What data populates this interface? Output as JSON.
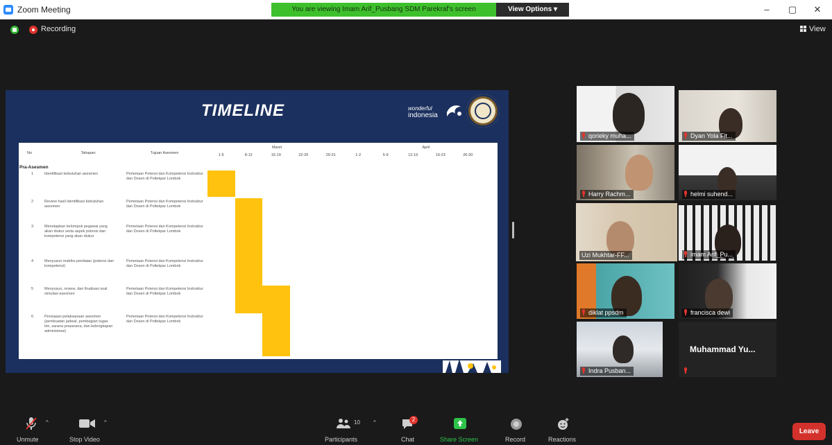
{
  "window": {
    "title": "Zoom Meeting",
    "share_banner": "You are viewing Imam Arif_Pusbang SDM Parekraf's screen",
    "view_options": "View Options ▾",
    "minimize": "–",
    "maximize": "▢",
    "close": "✕"
  },
  "status": {
    "recording_label": "Recording",
    "view_label": "View"
  },
  "slide": {
    "title": "TIMELINE",
    "brand_line1": "wonderful",
    "brand_line2": "indonesia",
    "table": {
      "headers": {
        "no": "No",
        "tahapan": "Tahapan",
        "tujuan": "Tujuan Asesmen",
        "month1": "Maret",
        "month2": "April"
      },
      "date_columns": [
        "1-5",
        "8-12",
        "15-19",
        "22-26",
        "29-31",
        "1-2",
        "5-9",
        "12-16",
        "19-23",
        "26-30"
      ],
      "section_label": "Pra-Asesmen",
      "rows": [
        {
          "no": "1",
          "tahapan": "Identifikasi kebutuhan asesmen",
          "tujuan": "Pemetaan Potensi dan Kompetensi Instruktur dan Dosen di Poltekpar Lombok",
          "bar_start": 0,
          "bar_span": 1
        },
        {
          "no": "2",
          "tahapan": "Review hasil identifikasi kebutuhan asesmen",
          "tujuan": "Pemetaan Potensi dan Kompetensi Instruktur dan Dosen di Poltekpar Lombok",
          "bar_start": 1,
          "bar_span": 1
        },
        {
          "no": "3",
          "tahapan": "Menetapkan kelompok pegawai yang akan diukur serta aspek potensi dan kompetensi yang akan diukur",
          "tujuan": "Pemetaan Potensi dan Kompetensi Instruktur dan Dosen di Poltekpar Lombok",
          "bar_start": 1,
          "bar_span": 1
        },
        {
          "no": "4",
          "tahapan": "Menyusun matriks penilaian (potensi dan kompetensi)",
          "tujuan": "Pemetaan Potensi dan Kompetensi Instruktur dan Dosen di Poltekpar Lombok",
          "bar_start": 1,
          "bar_span": 1
        },
        {
          "no": "5",
          "tahapan": "Menyusun, review, dan finalisasi soal simulasi asesmen",
          "tujuan": "Pemetaan Potensi dan Kompetensi Instruktur dan Dosen di Poltekpar Lombok",
          "bar_start": 1,
          "bar_span": 2
        },
        {
          "no": "6",
          "tahapan": "Persiapan pelaksanaan asesmen (pembuatan jadwal, pembagian tugas tim, sarana prasarana, dan kelengkapan administrasi)",
          "tujuan": "Pemetaan Potensi dan Kompetensi Instruktur dan Dosen di Poltekpar Lombok",
          "bar_start": 2,
          "bar_span": 1
        }
      ]
    }
  },
  "participants": [
    {
      "name": "qorieky muha...",
      "muted": true
    },
    {
      "name": "Dyan Yola Fit...",
      "muted": true
    },
    {
      "name": "Harry Rachm...",
      "muted": true
    },
    {
      "name": "helmi suhend...",
      "muted": true
    },
    {
      "name": "Uzi Mukhtar-FF...",
      "muted": false
    },
    {
      "name": "imam Arif_Pu...",
      "muted": true
    },
    {
      "name": "diklat ppsdm",
      "muted": true
    },
    {
      "name": "francisca dewi",
      "muted": true
    },
    {
      "name": "Indra Pusban...",
      "muted": true
    },
    {
      "name": "Muhammad Yu...",
      "muted": true
    }
  ],
  "toolbar": {
    "unmute": "Unmute",
    "stop_video": "Stop Video",
    "participants": "Participants",
    "participants_count": "10",
    "chat": "Chat",
    "chat_badge": "2",
    "share_screen": "Share Screen",
    "record": "Record",
    "reactions": "Reactions",
    "leave": "Leave"
  },
  "colors": {
    "share_banner": "#3ec02d",
    "slide_bg": "#1b305e",
    "timeline_bar": "#ffc20e",
    "active_speaker": "#c2e542",
    "leave": "#d3322c",
    "share_screen": "#2ec34a"
  }
}
